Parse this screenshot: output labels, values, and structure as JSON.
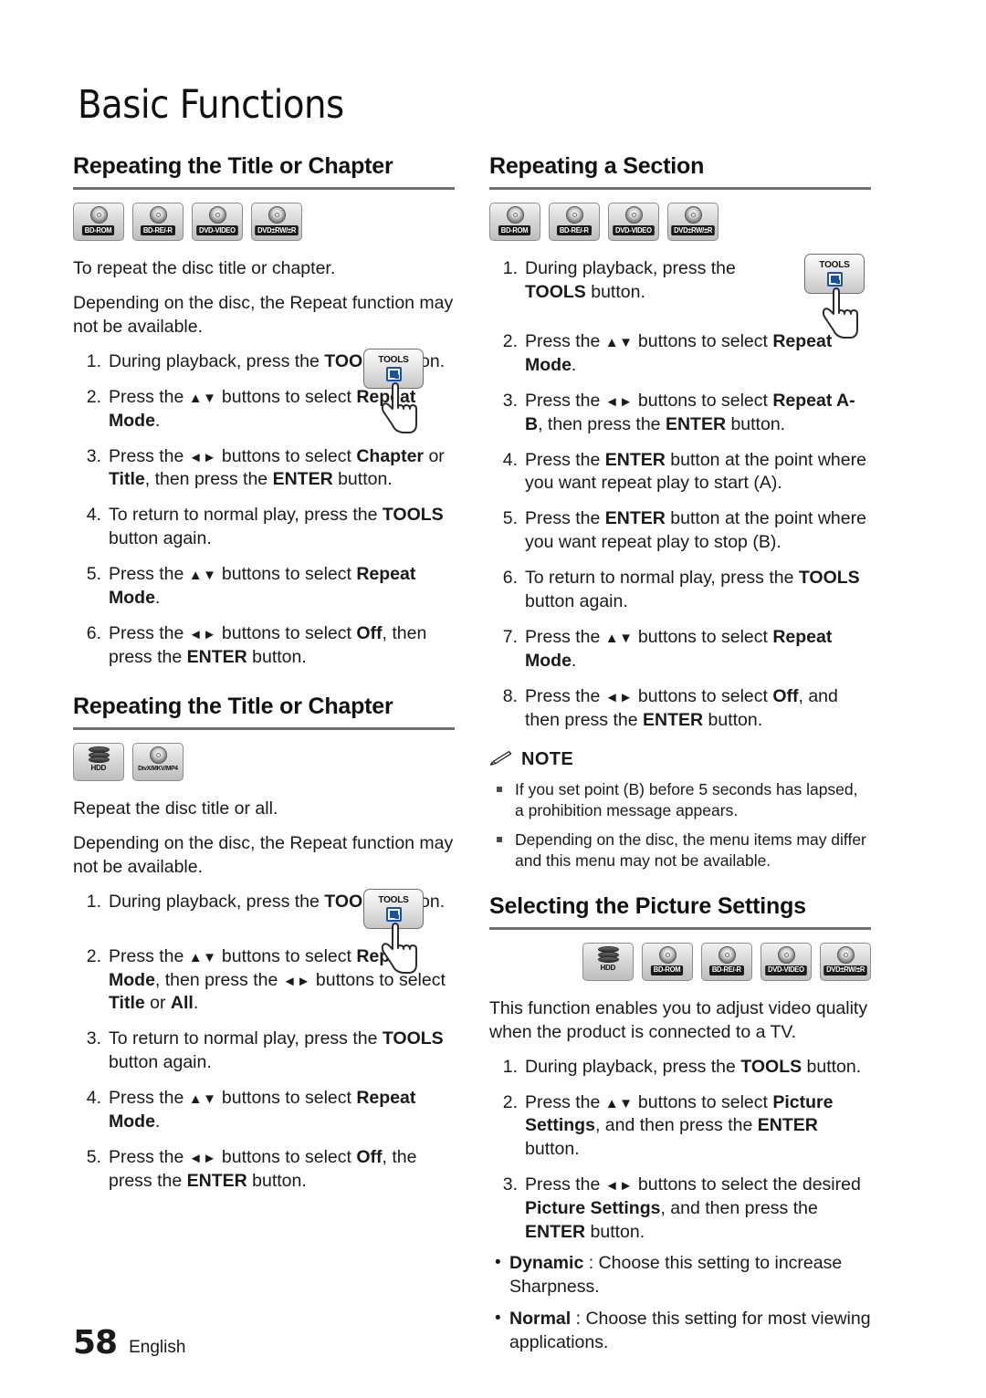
{
  "page": {
    "chapter_title": "Basic Functions",
    "page_number": "58",
    "language": "English"
  },
  "sections": [
    {
      "id": "repeating-title-chapter-1",
      "heading": "Repeating the Title or Chapter",
      "discs": [
        {
          "type": "disc",
          "label": "BD-ROM",
          "dark": true
        },
        {
          "type": "disc",
          "label": "BD-RE/-R",
          "dark": true
        },
        {
          "type": "disc",
          "label": "DVD-VIDEO",
          "dark": true
        },
        {
          "type": "disc",
          "label": "DVD±RW/±R",
          "dark": true
        }
      ],
      "intro": [
        "To repeat the disc title or chapter.",
        "Depending on the disc, the Repeat function may not be available."
      ],
      "steps": [
        {
          "n": "1.",
          "html": "During playback, press the <b>TOOLS</b> button."
        },
        {
          "n": "2.",
          "html": "Press the <span class=\"arrows\">▲▼</span> buttons to select <b>Repeat Mode</b>."
        },
        {
          "n": "3.",
          "html": "Press the <span class=\"arrows\">◄►</span> buttons to select <b>Chapter</b> or <b>Title</b>, then press the <b>ENTER</b> button."
        },
        {
          "n": "4.",
          "html": "To return to normal play, press the <b>TOOLS</b> button again."
        },
        {
          "n": "5.",
          "html": "Press the <span class=\"arrows\">▲▼</span> buttons to select <b>Repeat Mode</b>."
        },
        {
          "n": "6.",
          "html": "Press the <span class=\"arrows\">◄►</span> buttons to select <b>Off</b>, then press the <b>ENTER</b> button."
        }
      ]
    },
    {
      "id": "repeating-title-chapter-2",
      "heading": "Repeating the Title or Chapter",
      "discs": [
        {
          "type": "hdd",
          "label": "HDD",
          "dark": false
        },
        {
          "type": "disc",
          "label": "DivX/MKV/MP4",
          "dark": false
        }
      ],
      "intro": [
        "Repeat the disc title or all.",
        "Depending on the disc, the Repeat function may not be available."
      ],
      "steps": [
        {
          "n": "1.",
          "html": "During playback, press the <b>TOOLS</b> button."
        },
        {
          "n": "2.",
          "html": "Press the <span class=\"arrows\">▲▼</span> buttons to select <b>Repeat Mode</b>, then press the <span class=\"arrows\">◄►</span> buttons to select <b>Title</b> or <b>All</b>."
        },
        {
          "n": "3.",
          "html": "To return to normal play, press the <b>TOOLS</b> button again."
        },
        {
          "n": "4.",
          "html": "Press the <span class=\"arrows\">▲▼</span> buttons to select <b>Repeat Mode</b>."
        },
        {
          "n": "5.",
          "html": "Press the <span class=\"arrows\">◄►</span> buttons to select <b>Off</b>, the press the <b>ENTER</b> button."
        }
      ]
    },
    {
      "id": "repeating-a-section",
      "heading": "Repeating a Section",
      "discs": [
        {
          "type": "disc",
          "label": "BD-ROM",
          "dark": true
        },
        {
          "type": "disc",
          "label": "BD-RE/-R",
          "dark": true
        },
        {
          "type": "disc",
          "label": "DVD-VIDEO",
          "dark": true
        },
        {
          "type": "disc",
          "label": "DVD±RW/±R",
          "dark": true
        }
      ],
      "steps": [
        {
          "n": "1.",
          "html": "During playback, press the <b>TOOLS</b> button."
        },
        {
          "n": "2.",
          "html": "Press the <span class=\"arrows\">▲▼</span> buttons to select <b>Repeat Mode</b>."
        },
        {
          "n": "3.",
          "html": "Press the <span class=\"arrows\">◄►</span> buttons to select <b>Repeat A-B</b>, then press the <b>ENTER</b> button."
        },
        {
          "n": "4.",
          "html": "Press the <b>ENTER</b> button at the point where you want repeat play to start (A)."
        },
        {
          "n": "5.",
          "html": "Press the <b>ENTER</b> button at the point where you want repeat play to stop (B)."
        },
        {
          "n": "6.",
          "html": "To return to normal play, press the <b>TOOLS</b> button again."
        },
        {
          "n": "7.",
          "html": "Press the <span class=\"arrows\">▲▼</span> buttons to select <b>Repeat Mode</b>."
        },
        {
          "n": "8.",
          "html": "Press the <span class=\"arrows\">◄►</span> buttons to select <b>Off</b>, and then press the <b>ENTER</b> button."
        }
      ],
      "note": {
        "label": "NOTE",
        "items": [
          "If you set point (B) before 5 seconds has lapsed, a prohibition message appears.",
          "Depending on the disc, the menu items may differ and this menu may not be available."
        ]
      }
    },
    {
      "id": "selecting-picture-settings",
      "heading": "Selecting the Picture Settings",
      "discs": [
        {
          "type": "hdd",
          "label": "HDD",
          "dark": false
        },
        {
          "type": "disc",
          "label": "BD-ROM",
          "dark": true
        },
        {
          "type": "disc",
          "label": "BD-RE/-R",
          "dark": true
        },
        {
          "type": "disc",
          "label": "DVD-VIDEO",
          "dark": true
        },
        {
          "type": "disc",
          "label": "DVD±RW/±R",
          "dark": true
        }
      ],
      "intro": [
        "This function enables you to adjust video quality when the product is connected to a TV."
      ],
      "steps": [
        {
          "n": "1.",
          "html": "During playback, press the <b>TOOLS</b> button."
        },
        {
          "n": "2.",
          "html": "Press the <span class=\"arrows\">▲▼</span> buttons to select <b>Picture Settings</b>, and then press the <b>ENTER</b> button."
        },
        {
          "n": "3.",
          "html": "Press the <span class=\"arrows\">◄►</span> buttons to select the desired <b>Picture Settings</b>, and then press the <b>ENTER</b> button."
        }
      ],
      "bullets": [
        {
          "term": "Dynamic",
          "rest": " : Choose this setting to increase Sharpness."
        },
        {
          "term": "Normal",
          "rest": " : Choose this setting for most viewing applications."
        }
      ]
    }
  ]
}
